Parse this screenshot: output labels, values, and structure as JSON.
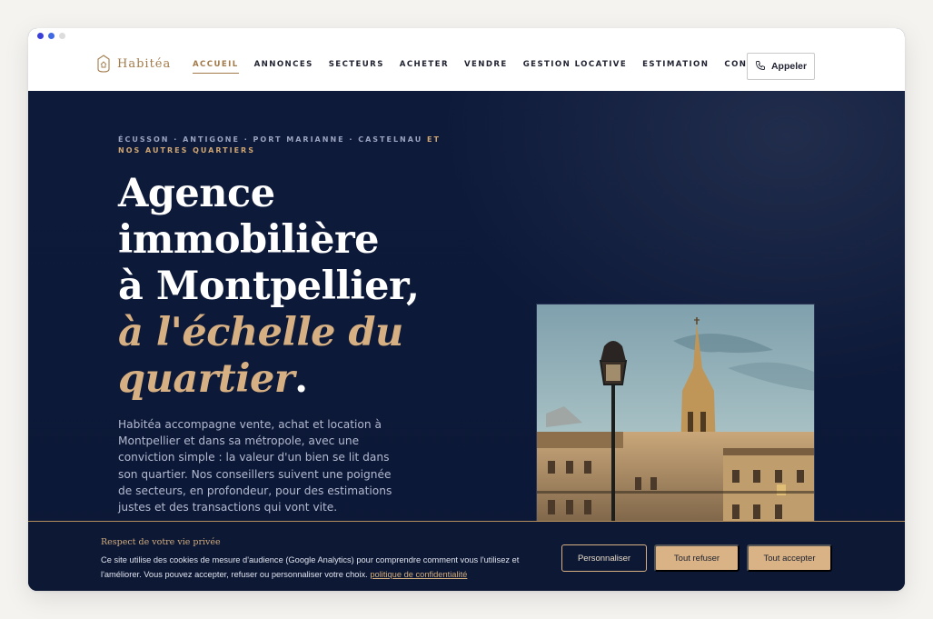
{
  "window": {
    "dots": [
      "blue",
      "blue",
      "grey"
    ]
  },
  "brand": {
    "name": "Habitéa",
    "logo_icon": "house-crest-icon"
  },
  "nav": {
    "items": [
      {
        "label": "ACCUEIL",
        "active": true
      },
      {
        "label": "ANNONCES",
        "active": false
      },
      {
        "label": "SECTEURS",
        "active": false
      },
      {
        "label": "ACHETER",
        "active": false
      },
      {
        "label": "VENDRE",
        "active": false
      },
      {
        "label": "GESTION LOCATIVE",
        "active": false
      },
      {
        "label": "ESTIMATION",
        "active": false
      },
      {
        "label": "CONTACT",
        "active": false
      }
    ],
    "call": {
      "label": "Appeler",
      "icon": "phone-icon"
    }
  },
  "hero": {
    "quartiers": "ÉCUSSON · ANTIGONE · PORT MARIANNE · CASTELNAU",
    "quartiers_more": "ET NOS AUTRES QUARTIERS",
    "headline_line1": "Agence",
    "headline_line2": "immobilière",
    "headline_line3": "à Montpellier,",
    "headline_italic1": "à l'échelle du",
    "headline_italic2": "quartier",
    "headline_period": ".",
    "intro": "Habitéa accompagne vente, achat et location à Montpellier et dans sa métropole, avec une conviction simple : la valeur d'un bien se lit dans son quartier. Nos conseillers suivent une poignée de secteurs, en profondeur, pour des estimations justes et des transactions qui vont vite."
  },
  "cookie": {
    "title": "Respect de votre vie privée",
    "text": "Ce site utilise des cookies de mesure d'audience (Google Analytics) pour comprendre comment vous l'utilisez et l'améliorer. Vous pouvez accepter, refuser ou personnaliser votre choix.",
    "link": "politique de confidentialité",
    "btn_customize": "Personnaliser",
    "btn_refuse": "Tout refuser",
    "btn_accept": "Tout accepter"
  },
  "colors": {
    "navy": "#0e1a3a",
    "gold": "#d6b083",
    "brand_gold": "#a27a4a"
  }
}
